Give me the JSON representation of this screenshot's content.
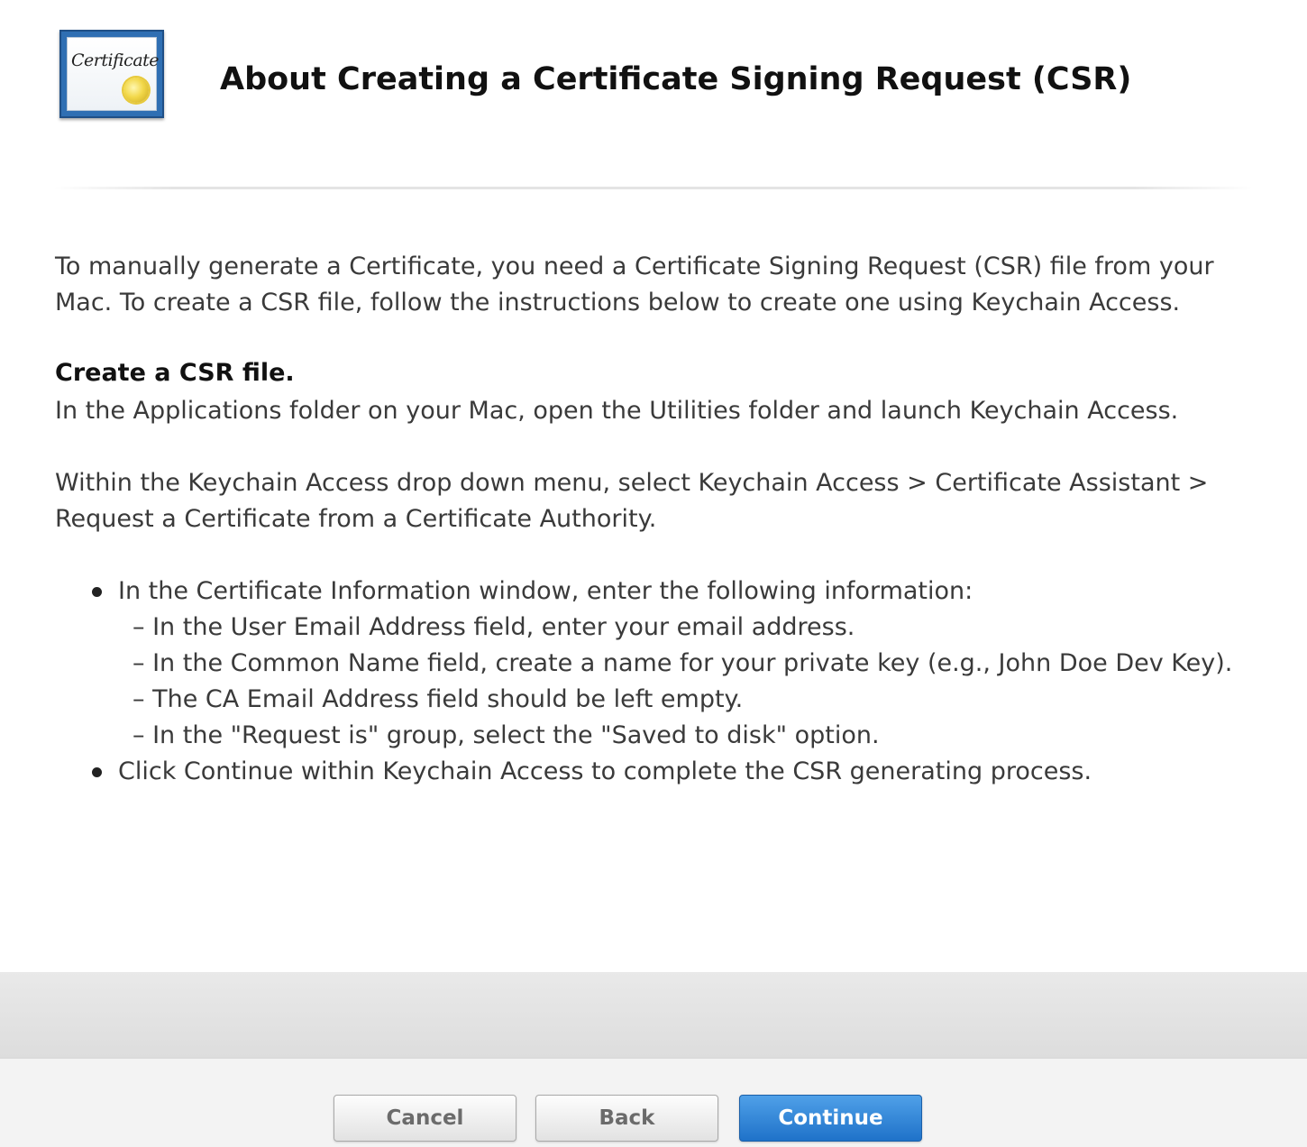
{
  "header": {
    "icon_name": "certificate-icon",
    "icon_text": "Certificate",
    "title": "About Creating a Certificate Signing Request (CSR)"
  },
  "content": {
    "intro": "To manually generate a Certificate, you need a Certificate Signing Request (CSR) file from your Mac. To create a CSR file, follow the instructions below to create one using Keychain Access.",
    "section_heading": "Create a CSR file.",
    "step1": "In the Applications folder on your Mac, open the Utilities folder and launch Keychain Access.",
    "step2": "Within the Keychain Access drop down menu, select Keychain Access > Certificate Assistant > Request a Certificate from a Certificate Authority.",
    "bullets": [
      {
        "text": "In the Certificate Information window, enter the following information:",
        "sub": [
          "– In the User Email Address field, enter your email address.",
          "– In the Common Name field, create a name for your private key (e.g., John Doe Dev Key).",
          "– The CA Email Address field should be left empty.",
          "– In the \"Request is\" group, select the \"Saved to disk\" option."
        ]
      },
      {
        "text": "Click Continue within Keychain Access to complete the CSR generating process."
      }
    ]
  },
  "footer": {
    "cancel_label": "Cancel",
    "back_label": "Back",
    "continue_label": "Continue"
  },
  "colors": {
    "primary_button": "#2a7fd4",
    "title": "#111111",
    "body_text": "#3a3a3a"
  }
}
